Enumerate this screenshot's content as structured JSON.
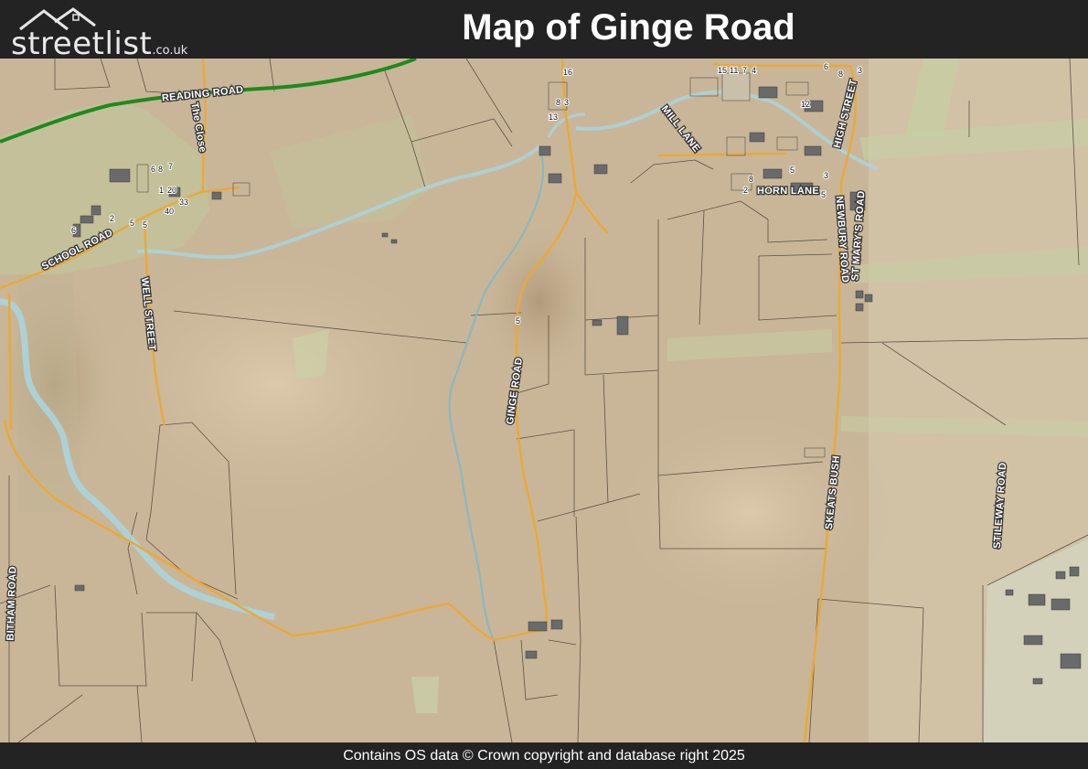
{
  "header": {
    "logo_main": "streetlist",
    "logo_suffix": ".co.uk",
    "title": "Map of Ginge Road"
  },
  "map": {
    "road_labels": {
      "reading_road": "READING ROAD",
      "the_close": "The Close",
      "school_road": "SCHOOL ROAD",
      "well_street": "WELL STREET",
      "ginge_road": "GINGE ROAD",
      "mill_lane": "MILL LANE",
      "high_street": "HIGH STREET",
      "horn_lane": "HORN LANE",
      "newbury_road": "NEWBURY ROAD",
      "st_marys_road": "ST MARY'S ROAD",
      "skeats_bush": "SKEATS BUSH",
      "stileway_road": "STILEWAY ROAD",
      "bitham_road": "BITHAM ROAD"
    },
    "house_numbers": {
      "n6a": "6",
      "n8a": "8",
      "n7a": "7",
      "n1": "1",
      "n20": "20",
      "n33": "33",
      "n40": "40",
      "n2a": "2",
      "n5a": "5",
      "n5b": "5",
      "n6b": "6",
      "n16": "16",
      "n8b": "8",
      "n3a": "3",
      "n13": "13",
      "n15": "15",
      "n11": "11",
      "n7b": "7",
      "n4": "4",
      "n6c": "6",
      "n8c": "8",
      "n3b": "3",
      "n12": "12",
      "n5c": "5",
      "n3c": "3",
      "n8d": "8",
      "n2b": "2",
      "n5d": "5",
      "n5e": "5"
    },
    "colors": {
      "land": "#c8b496",
      "river": "#a9d6e0",
      "minor_road": "#e8a93c",
      "a_road": "#1f8a1f",
      "building": "#6f6f6f"
    }
  },
  "footer": {
    "copyright": "Contains OS data © Crown copyright and database right 2025"
  }
}
